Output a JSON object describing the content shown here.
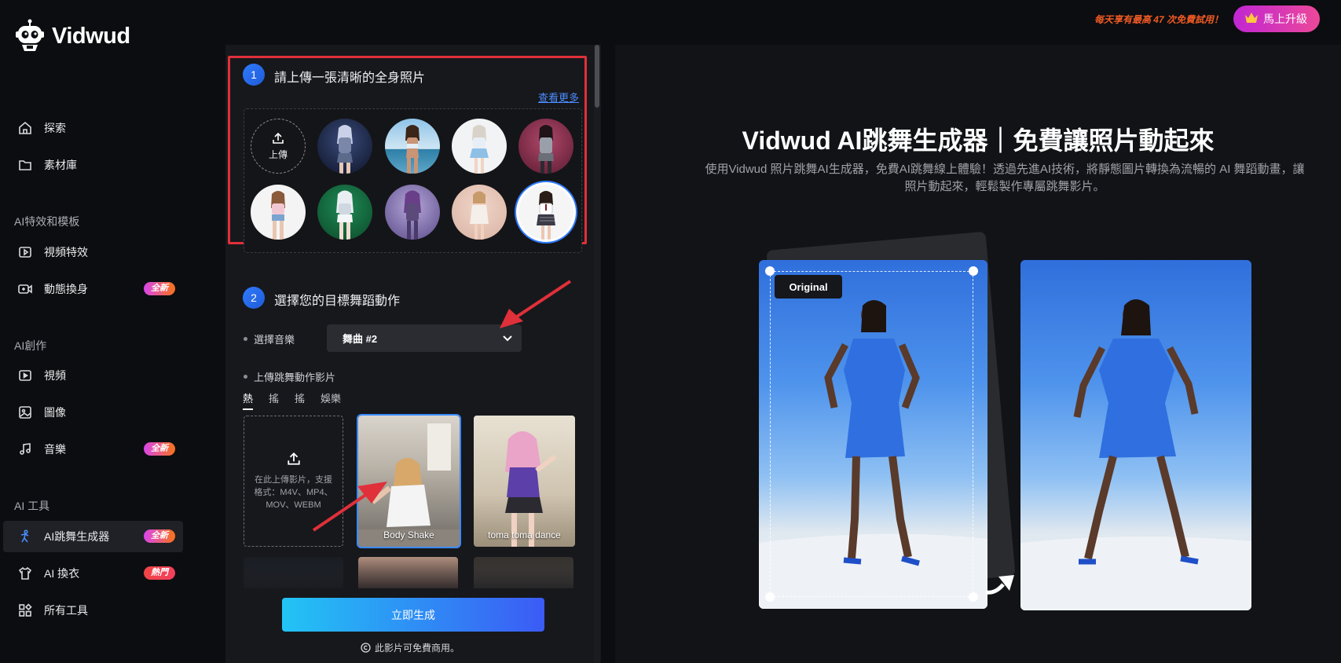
{
  "app": {
    "name": "Vidwud"
  },
  "topbar": {
    "promo": "每天享有最高 47 次免費試用！",
    "upgrade_label": "馬上升級",
    "upgrade_icon": "crown-icon"
  },
  "sidebar": {
    "main_items": [
      {
        "label": "探索",
        "icon": "home-icon"
      },
      {
        "label": "素材庫",
        "icon": "folder-icon"
      }
    ],
    "sections": [
      {
        "title": "AI特效和模板",
        "items": [
          {
            "label": "視頻特效",
            "icon": "video-effect-icon",
            "badge": ""
          },
          {
            "label": "動態換身",
            "icon": "camera-swap-icon",
            "badge": "全新"
          }
        ]
      },
      {
        "title": "AI創作",
        "items": [
          {
            "label": "視頻",
            "icon": "video-play-icon",
            "badge": ""
          },
          {
            "label": "圖像",
            "icon": "image-icon",
            "badge": ""
          },
          {
            "label": "音樂",
            "icon": "music-icon",
            "badge": "全新"
          }
        ]
      },
      {
        "title": "AI 工具",
        "items": [
          {
            "label": "AI跳舞生成器",
            "icon": "dance-icon",
            "badge": "全新",
            "active": true
          },
          {
            "label": "AI 換衣",
            "icon": "shirt-icon",
            "badge": "熱門"
          },
          {
            "label": "所有工具",
            "icon": "grid-icon",
            "badge": ""
          }
        ]
      }
    ]
  },
  "step1": {
    "number": "1",
    "title": "請上傳一張清晰的全身照片",
    "see_more": "查看更多",
    "upload_label": "上傳",
    "avatar_count": 9
  },
  "step2": {
    "number": "2",
    "title": "選擇您的目標舞蹈動作",
    "music_label": "選擇音樂",
    "music_value": "舞曲 #2",
    "upload_video_label": "上傳跳舞動作影片",
    "tabs": [
      "熱",
      "搖",
      "搖",
      "娛樂"
    ],
    "upload_hint": "在此上傳影片，支援格式：M4V、MP4、MOV、WEBM",
    "videos": [
      {
        "caption": "Body Shake",
        "selected": true
      },
      {
        "caption": "toma toma dance",
        "selected": false
      }
    ]
  },
  "actions": {
    "generate_label": "立即生成",
    "free_note": "此影片可免費商用。"
  },
  "hero": {
    "title": "Vidwud AI跳舞生成器｜免費讓照片動起來",
    "subtitle": "使用Vidwud 照片跳舞AI生成器，免費AI跳舞線上體驗！透過先進AI技術，將靜態圖片轉換為流暢的 AI 舞蹈動畫，讓照片動起來，輕鬆製作專屬跳舞影片。",
    "original_tag": "Original"
  },
  "colors": {
    "accent": "#2f7bff",
    "highlight": "#e0303a",
    "promo": "#f05a24"
  }
}
